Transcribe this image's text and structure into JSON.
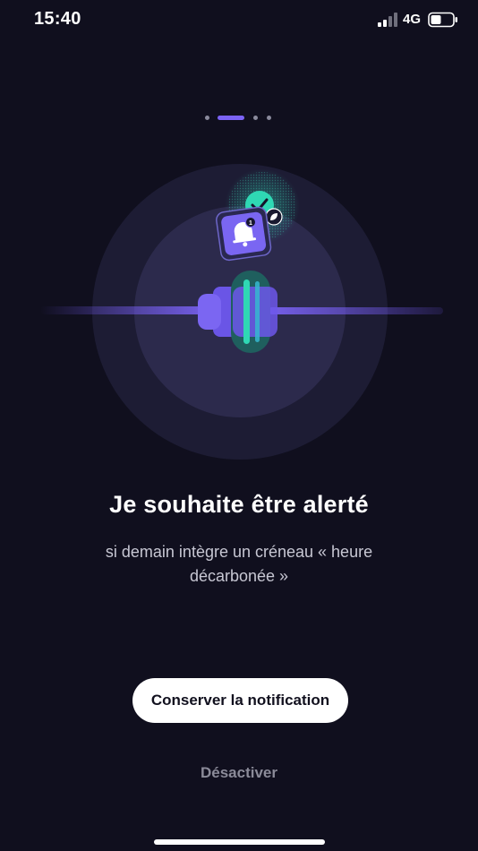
{
  "status_bar": {
    "time": "15:40",
    "network": "4G",
    "signal_icon": "cellular-signal-icon",
    "battery_icon": "battery-icon"
  },
  "page_indicator": {
    "total": 4,
    "active_index": 1
  },
  "illustration": {
    "icons": [
      "bell-icon",
      "check-icon",
      "leaf-icon",
      "plug-icon"
    ],
    "notification_badge": "1"
  },
  "content": {
    "title": "Je souhaite être alerté",
    "subtitle": "si demain intègre un créneau « heure décarbonée »"
  },
  "actions": {
    "primary_label": "Conserver la notification",
    "secondary_label": "Désactiver"
  },
  "colors": {
    "background": "#100f1e",
    "accent_purple": "#7b63f5",
    "accent_green": "#2fd8b4",
    "primary_button_bg": "#ffffff",
    "secondary_text": "#8b8b99"
  }
}
